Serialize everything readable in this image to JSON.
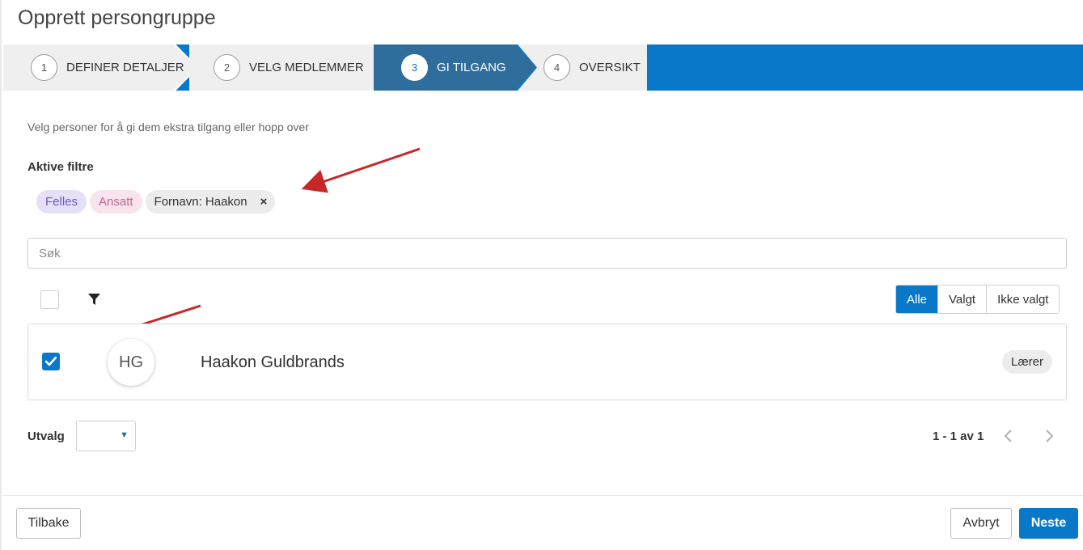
{
  "page": {
    "title": "Opprett persongruppe"
  },
  "stepper": {
    "steps": [
      {
        "number": "1",
        "label": "DEFINER DETALJER",
        "state": "done"
      },
      {
        "number": "2",
        "label": "VELG MEDLEMMER",
        "state": "done"
      },
      {
        "number": "3",
        "label": "GI TILGANG",
        "state": "active"
      },
      {
        "number": "4",
        "label": "OVERSIKT",
        "state": "upcoming"
      }
    ]
  },
  "main": {
    "subtitle": "Velg personer for å gi dem ekstra tilgang eller hopp over",
    "filters_label": "Aktive filtre",
    "filter_chips": [
      {
        "label": "Felles"
      },
      {
        "label": "Ansatt"
      },
      {
        "label": "Fornavn: Haakon",
        "remove_icon": "×"
      }
    ],
    "search": {
      "placeholder": "Søk",
      "value": ""
    },
    "select_all_checked": false,
    "filter_icon": "funnel-icon",
    "view_toggle": {
      "options": [
        "Alle",
        "Valgt",
        "Ikke valgt"
      ],
      "selected": "Alle"
    },
    "people": [
      {
        "initials": "HG",
        "name": "Haakon Guldbrands",
        "role": "Lærer",
        "checked": true
      }
    ],
    "utvalg": {
      "label": "Utvalg",
      "value": ""
    },
    "pager": {
      "text": "1 - 1 av 1"
    }
  },
  "footer": {
    "back_label": "Tilbake",
    "cancel_label": "Avbryt",
    "next_label": "Neste"
  },
  "colors": {
    "accent": "#0a78c8",
    "active_step": "#2f6e9c",
    "step_bg": "#efefef",
    "annotation_arrow": "#c62828"
  }
}
